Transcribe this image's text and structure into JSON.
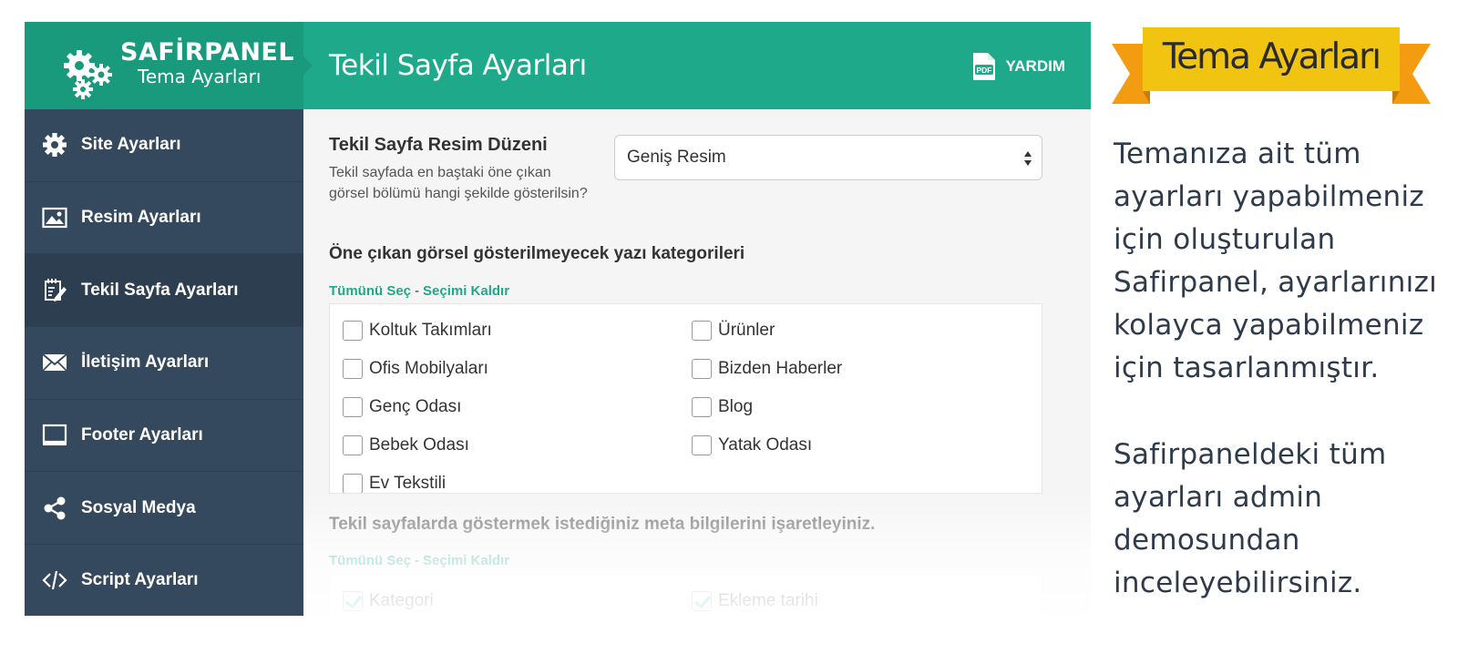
{
  "brand": {
    "title": "SAFİRPANEL",
    "subtitle": "Tema Ayarları",
    "icon": "gears-icon"
  },
  "header": {
    "title": "Tekil Sayfa Ayarları",
    "help_label": "YARDIM",
    "help_icon": "pdf-icon",
    "pdf_badge": "PDF"
  },
  "sidebar": {
    "items": [
      {
        "label": "Site Ayarları",
        "icon": "gear-icon"
      },
      {
        "label": "Resim Ayarları",
        "icon": "image-icon"
      },
      {
        "label": "Tekil Sayfa Ayarları",
        "icon": "edit-icon",
        "active": true
      },
      {
        "label": "İletişim Ayarları",
        "icon": "envelope-icon"
      },
      {
        "label": "Footer Ayarları",
        "icon": "monitor-icon"
      },
      {
        "label": "Sosyal Medya",
        "icon": "share-icon"
      },
      {
        "label": "Script Ayarları",
        "icon": "code-icon"
      }
    ]
  },
  "image_layout": {
    "title": "Tekil Sayfa Resim Düzeni",
    "description": "Tekil sayfada en baştaki öne çıkan görsel bölümü hangi şekilde gösterilsin?",
    "selected": "Geniş Resim"
  },
  "categories": {
    "title": "Öne çıkan görsel gösterilmeyecek yazı kategorileri",
    "select_all": "Tümünü Seç",
    "separator": "-",
    "deselect": "Seçimi Kaldır",
    "items": [
      {
        "label": "Koltuk Takımları",
        "checked": false
      },
      {
        "label": "Ürünler",
        "checked": false
      },
      {
        "label": "Ofis Mobilyaları",
        "checked": false
      },
      {
        "label": "Bizden Haberler",
        "checked": false
      },
      {
        "label": "Genç Odası",
        "checked": false
      },
      {
        "label": "Blog",
        "checked": false
      },
      {
        "label": "Bebek Odası",
        "checked": false
      },
      {
        "label": "Yatak Odası",
        "checked": false
      },
      {
        "label": "Ev Tekstili",
        "checked": false
      }
    ]
  },
  "meta": {
    "title": "Tekil sayfalarda göstermek istediğiniz meta bilgilerini işaretleyiniz.",
    "select_all": "Tümünü Seç",
    "separator": "-",
    "deselect": "Seçimi Kaldır",
    "items": [
      {
        "label": "Kategori",
        "checked": true
      },
      {
        "label": "Ekleme tarihi",
        "checked": true
      }
    ]
  },
  "promo": {
    "ribbon_text": "Tema Ayarları",
    "paragraph1": "Temanıza ait tüm ayarları yapabilmeniz için oluşturulan Safirpanel, ayarlarınızı kolayca yapabilmeniz için tasarlanmıştır.",
    "paragraph2": "Safirpaneldeki tüm ayarları admin demosundan inceleyebilirsiniz."
  },
  "colors": {
    "brand_green": "#1a9a7d",
    "header_green": "#1fa98b",
    "sidebar_bg": "#35495e",
    "sidebar_active": "#2c3e50",
    "ribbon_yellow": "#f2c412",
    "ribbon_orange": "#f39c12"
  }
}
